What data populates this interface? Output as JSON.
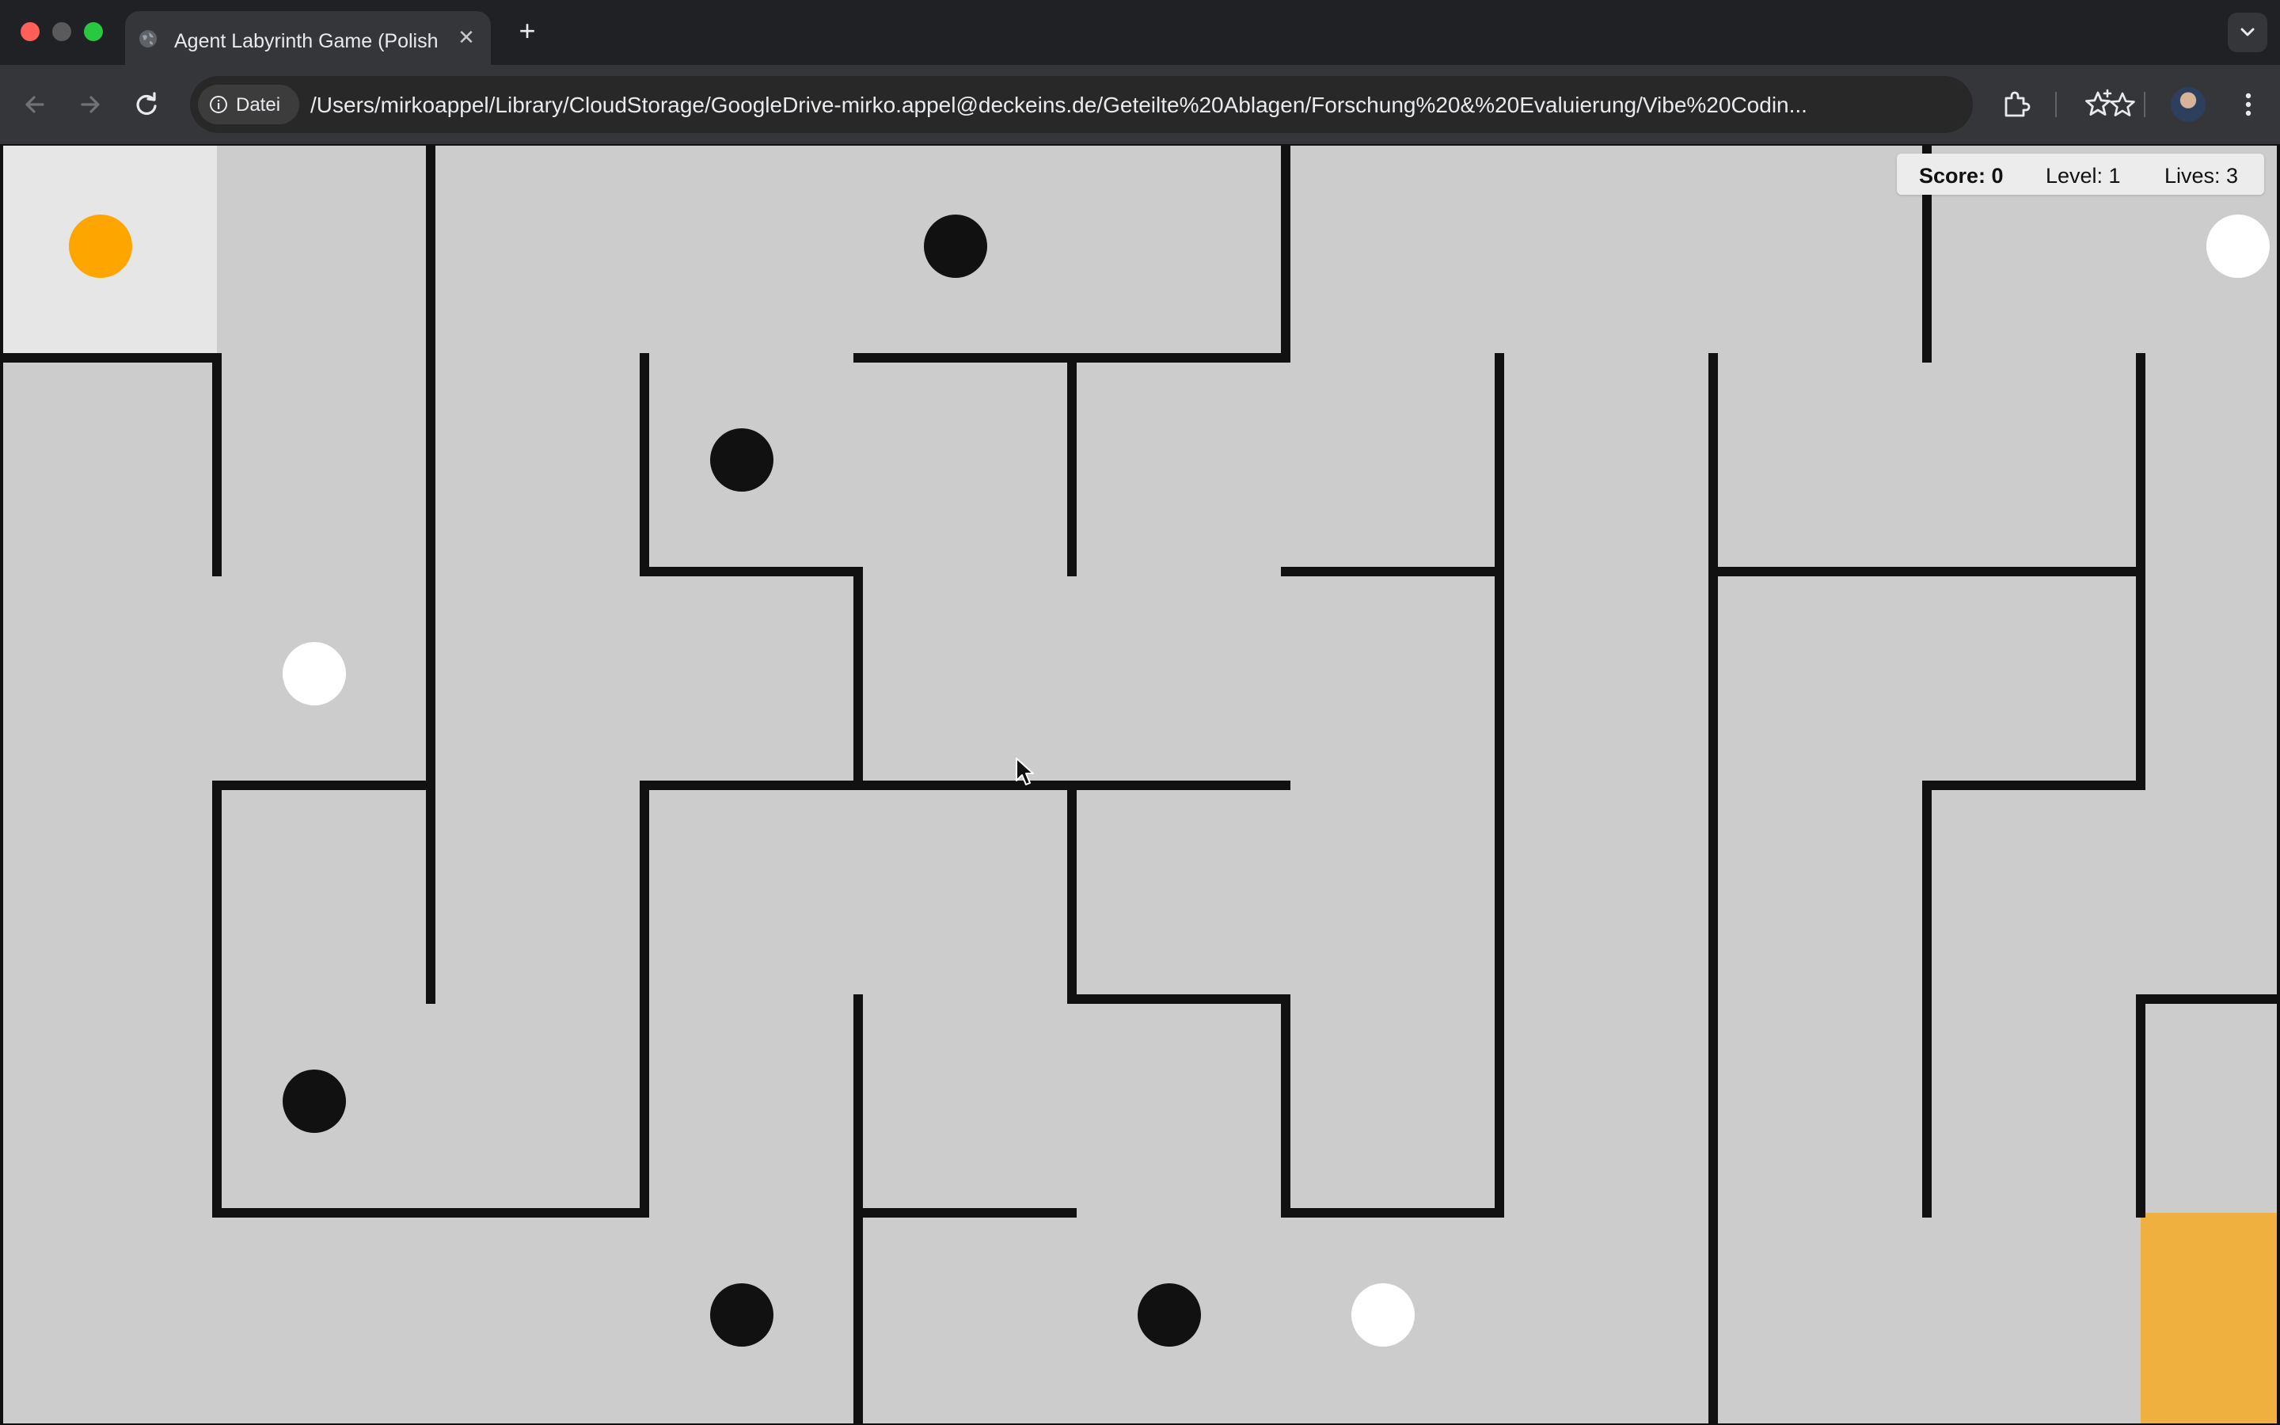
{
  "browser": {
    "tab_title": "Agent Labyrinth Game (Polish",
    "tab_close": "✕",
    "new_tab": "+",
    "url_scheme_label": "Datei",
    "url": "/Users/mirkoappel/Library/CloudStorage/GoogleDrive-mirko.appel@deckeins.de/Geteilte%20Ablagen/Forschung%20&%20Evaluierung/Vibe%20Codin..."
  },
  "hud": {
    "score": "Score: 0",
    "level": "Level: 1",
    "lives": "Lives: 3"
  },
  "colors": {
    "maze_background": "#cccccc",
    "walls": "#111111",
    "start_cell": "#e6e6e6",
    "goal": "#f0b040",
    "player": "#ffa500",
    "enemy": "#111111",
    "collectible": "#ffffff"
  },
  "maze": {
    "columns": 11,
    "rows": 6,
    "cell_size": 270,
    "wall_thickness": 12,
    "start_cell": [
      0,
      0
    ],
    "goal_cell": [
      10,
      5
    ],
    "walls": [
      {
        "from": [
          0,
          1
        ],
        "to": [
          1,
          1
        ]
      },
      {
        "from": [
          1,
          1
        ],
        "to": [
          1,
          2
        ]
      },
      {
        "from": [
          2,
          0
        ],
        "to": [
          2,
          4
        ]
      },
      {
        "from": [
          1,
          3
        ],
        "to": [
          2,
          3
        ]
      },
      {
        "from": [
          1,
          3
        ],
        "to": [
          1,
          5
        ]
      },
      {
        "from": [
          1,
          5
        ],
        "to": [
          3,
          5
        ]
      },
      {
        "from": [
          3,
          3
        ],
        "to": [
          3,
          5
        ]
      },
      {
        "from": [
          3,
          3
        ],
        "to": [
          6,
          3
        ]
      },
      {
        "from": [
          3,
          1
        ],
        "to": [
          3,
          2
        ]
      },
      {
        "from": [
          3,
          2
        ],
        "to": [
          4,
          2
        ]
      },
      {
        "from": [
          4,
          2
        ],
        "to": [
          4,
          3
        ]
      },
      {
        "from": [
          4,
          1
        ],
        "to": [
          6,
          1
        ]
      },
      {
        "from": [
          6,
          0
        ],
        "to": [
          6,
          1
        ]
      },
      {
        "from": [
          5,
          1
        ],
        "to": [
          5,
          2
        ]
      },
      {
        "from": [
          6,
          2
        ],
        "to": [
          7,
          2
        ]
      },
      {
        "from": [
          7,
          1
        ],
        "to": [
          7,
          5
        ]
      },
      {
        "from": [
          5,
          3
        ],
        "to": [
          5,
          4
        ]
      },
      {
        "from": [
          5,
          4
        ],
        "to": [
          6,
          4
        ]
      },
      {
        "from": [
          6,
          4
        ],
        "to": [
          6,
          5
        ]
      },
      {
        "from": [
          6,
          5
        ],
        "to": [
          7,
          5
        ]
      },
      {
        "from": [
          4,
          4
        ],
        "to": [
          4,
          6
        ]
      },
      {
        "from": [
          4,
          5
        ],
        "to": [
          5,
          5
        ]
      },
      {
        "from": [
          8,
          1
        ],
        "to": [
          8,
          6
        ]
      },
      {
        "from": [
          8,
          2
        ],
        "to": [
          10,
          2
        ]
      },
      {
        "from": [
          10,
          1
        ],
        "to": [
          10,
          3
        ]
      },
      {
        "from": [
          9,
          0
        ],
        "to": [
          9,
          1
        ]
      },
      {
        "from": [
          9,
          3
        ],
        "to": [
          10,
          3
        ]
      },
      {
        "from": [
          9,
          3
        ],
        "to": [
          9,
          5
        ]
      },
      {
        "from": [
          10,
          4
        ],
        "to": [
          11,
          4
        ]
      },
      {
        "from": [
          10,
          4
        ],
        "to": [
          10,
          5
        ]
      }
    ]
  },
  "player": {
    "cell": [
      0,
      0
    ]
  },
  "enemies": [
    {
      "cell": [
        4,
        0
      ]
    },
    {
      "cell": [
        3,
        1
      ]
    },
    {
      "cell": [
        1,
        4
      ]
    },
    {
      "cell": [
        3,
        5
      ]
    },
    {
      "cell": [
        5,
        5
      ]
    }
  ],
  "collectibles": [
    {
      "cell": [
        1,
        2
      ]
    },
    {
      "cell": [
        10,
        0
      ]
    },
    {
      "cell": [
        6,
        5
      ]
    }
  ]
}
